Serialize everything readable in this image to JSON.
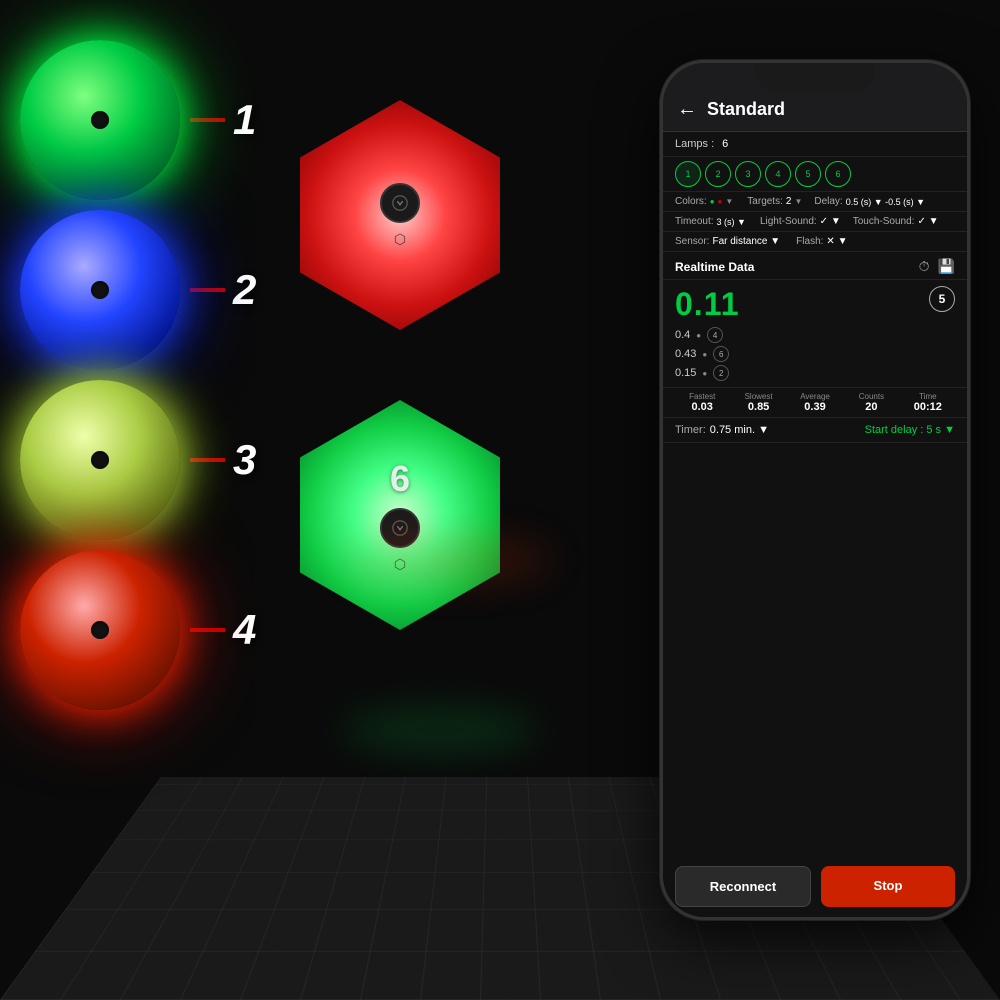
{
  "background": "#0a0a0a",
  "balls": [
    {
      "id": 1,
      "color": "green",
      "label": "1"
    },
    {
      "id": 2,
      "color": "blue",
      "label": "2"
    },
    {
      "id": 3,
      "color": "yellow",
      "label": "3"
    },
    {
      "id": 4,
      "color": "red",
      "label": "4"
    }
  ],
  "hexagons": [
    {
      "id": "hex-red",
      "color": "red",
      "number": ""
    },
    {
      "id": "hex-green",
      "color": "green",
      "number": "6"
    }
  ],
  "phone": {
    "header": {
      "back_label": "←",
      "title": "Standard"
    },
    "lamps": {
      "label": "Lamps :",
      "count": "6"
    },
    "lamp_numbers": [
      "1",
      "2",
      "3",
      "4",
      "5",
      "6"
    ],
    "config": {
      "colors_label": "Colors:",
      "colors_dots": "●▼",
      "targets_label": "Targets:",
      "targets_value": "2",
      "delay_label": "Delay:",
      "delay_value": "0.5 (s) ▼ -0.5 (s) ▼",
      "timeout_label": "Timeout:",
      "timeout_value": "3 (s) ▼",
      "light_sound_label": "Light-Sound:",
      "light_sound_value": "✓ ▼",
      "touch_sound_label": "Touch-Sound:",
      "touch_sound_value": "✓ ▼",
      "sensor_label": "Sensor:",
      "sensor_value": "Far distance ▼",
      "flash_label": "Flash:",
      "flash_value": "✕ ▼"
    },
    "realtime": {
      "title": "Realtime Data",
      "main_value": "0.11",
      "main_badge": "5",
      "sub_rows": [
        {
          "value": "0.4",
          "dot_color": "#888",
          "num": "4"
        },
        {
          "value": "0.43",
          "dot_color": "#888",
          "num": "6"
        },
        {
          "value": "0.15",
          "dot_color": "#888",
          "num": "2"
        }
      ]
    },
    "stats": {
      "fastest_label": "Fastest",
      "fastest_value": "0.03",
      "slowest_label": "Slowest",
      "slowest_value": "0.85",
      "average_label": "Average",
      "average_value": "0.39",
      "counts_label": "Counts",
      "counts_value": "20",
      "time_label": "Time",
      "time_value": "00:12"
    },
    "timer": {
      "label": "Timer:",
      "value": "0.75 min. ▼",
      "start_delay_label": "Start delay : 5 s ▼"
    },
    "buttons": {
      "reconnect": "Reconnect",
      "stop": "Stop"
    }
  }
}
